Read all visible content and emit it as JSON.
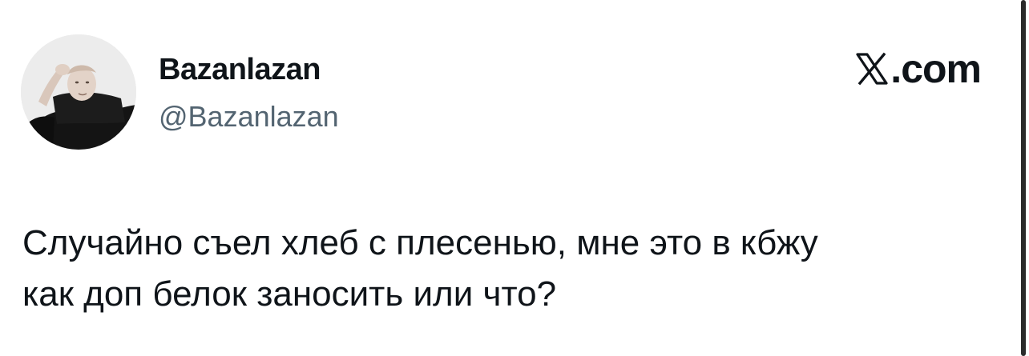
{
  "author": {
    "display_name": "Bazanlazan",
    "handle": "@Bazanlazan"
  },
  "brand": {
    "logo_icon": "x-logo-icon",
    "domain_suffix": ".com"
  },
  "tweet": {
    "line_1": "Случайно съел хлеб с плесенью, мне это в кбжу",
    "line_2": "как доп белок заносить или что?"
  },
  "colors": {
    "text_primary": "#0f1419",
    "text_secondary": "#536471",
    "background": "#ffffff"
  }
}
